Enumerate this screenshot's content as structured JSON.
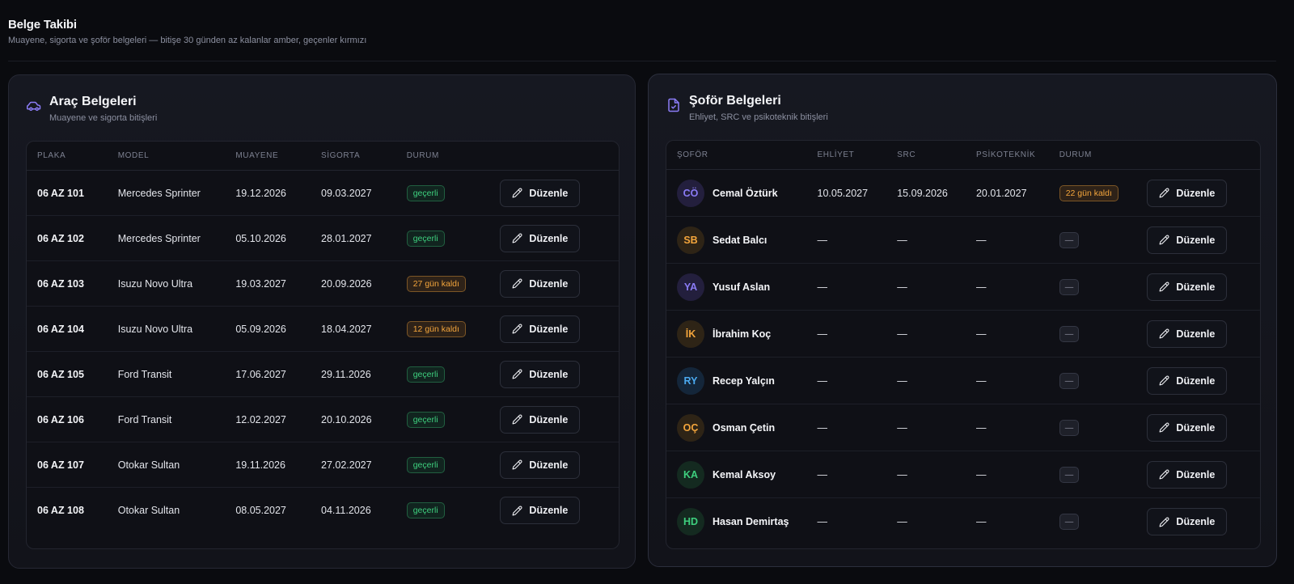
{
  "page": {
    "title": "Belge Takibi",
    "subtitle": "Muayene, sigorta ve şoför belgeleri — bitişe 30 günden az kalanlar amber, geçenler kırmızı"
  },
  "vehicle_panel": {
    "icon": "car-icon",
    "title": "Araç Belgeleri",
    "subtitle": "Muayene ve sigorta bitişleri",
    "columns": [
      "PLAKA",
      "MODEL",
      "MUAYENE",
      "SİGORTA",
      "DURUM",
      ""
    ],
    "rows": [
      {
        "plate": "06 AZ 101",
        "model": "Mercedes Sprinter",
        "inspection": "19.12.2026",
        "insurance": "09.03.2027",
        "status": "geçerli",
        "status_type": "ok",
        "action": "Düzenle"
      },
      {
        "plate": "06 AZ 102",
        "model": "Mercedes Sprinter",
        "inspection": "05.10.2026",
        "insurance": "28.01.2027",
        "status": "geçerli",
        "status_type": "ok",
        "action": "Düzenle"
      },
      {
        "plate": "06 AZ 103",
        "model": "Isuzu Novo Ultra",
        "inspection": "19.03.2027",
        "insurance": "20.09.2026",
        "status": "27 gün kaldı",
        "status_type": "warn",
        "action": "Düzenle"
      },
      {
        "plate": "06 AZ 104",
        "model": "Isuzu Novo Ultra",
        "inspection": "05.09.2026",
        "insurance": "18.04.2027",
        "status": "12 gün kaldı",
        "status_type": "warn",
        "action": "Düzenle"
      },
      {
        "plate": "06 AZ 105",
        "model": "Ford Transit",
        "inspection": "17.06.2027",
        "insurance": "29.11.2026",
        "status": "geçerli",
        "status_type": "ok",
        "action": "Düzenle"
      },
      {
        "plate": "06 AZ 106",
        "model": "Ford Transit",
        "inspection": "12.02.2027",
        "insurance": "20.10.2026",
        "status": "geçerli",
        "status_type": "ok",
        "action": "Düzenle"
      },
      {
        "plate": "06 AZ 107",
        "model": "Otokar Sultan",
        "inspection": "19.11.2026",
        "insurance": "27.02.2027",
        "status": "geçerli",
        "status_type": "ok",
        "action": "Düzenle"
      },
      {
        "plate": "06 AZ 108",
        "model": "Otokar Sultan",
        "inspection": "08.05.2027",
        "insurance": "04.11.2026",
        "status": "geçerli",
        "status_type": "ok",
        "action": "Düzenle"
      }
    ]
  },
  "driver_panel": {
    "icon": "document-check-icon",
    "title": "Şoför Belgeleri",
    "subtitle": "Ehliyet, SRC ve psikoteknik bitişleri",
    "columns": [
      "ŞOFÖR",
      "EHLİYET",
      "SRC",
      "PSİKOTEKNİK",
      "DURUM",
      ""
    ],
    "rows": [
      {
        "initials": "CÖ",
        "name": "Cemal Öztürk",
        "license": "10.05.2027",
        "src": "15.09.2026",
        "psycho": "20.01.2027",
        "status": "22 gün kaldı",
        "status_type": "warn",
        "avatar_fg": "#8b7cf6",
        "avatar_bg": "#231f3d",
        "action": "Düzenle"
      },
      {
        "initials": "SB",
        "name": "Sedat Balcı",
        "license": "—",
        "src": "—",
        "psycho": "—",
        "status": "—",
        "status_type": "none",
        "avatar_fg": "#f3a53c",
        "avatar_bg": "#2e2416",
        "action": "Düzenle"
      },
      {
        "initials": "YA",
        "name": "Yusuf Aslan",
        "license": "—",
        "src": "—",
        "psycho": "—",
        "status": "—",
        "status_type": "none",
        "avatar_fg": "#8b7cf6",
        "avatar_bg": "#231f3d",
        "action": "Düzenle"
      },
      {
        "initials": "İK",
        "name": "İbrahim Koç",
        "license": "—",
        "src": "—",
        "psycho": "—",
        "status": "—",
        "status_type": "none",
        "avatar_fg": "#f3a53c",
        "avatar_bg": "#2e2416",
        "action": "Düzenle"
      },
      {
        "initials": "RY",
        "name": "Recep Yalçın",
        "license": "—",
        "src": "—",
        "psycho": "—",
        "status": "—",
        "status_type": "none",
        "avatar_fg": "#4ba9ef",
        "avatar_bg": "#14263a",
        "action": "Düzenle"
      },
      {
        "initials": "OÇ",
        "name": "Osman Çetin",
        "license": "—",
        "src": "—",
        "psycho": "—",
        "status": "—",
        "status_type": "none",
        "avatar_fg": "#f3a53c",
        "avatar_bg": "#2e2416",
        "action": "Düzenle"
      },
      {
        "initials": "KA",
        "name": "Kemal Aksoy",
        "license": "—",
        "src": "—",
        "psycho": "—",
        "status": "—",
        "status_type": "none",
        "avatar_fg": "#3ecf7e",
        "avatar_bg": "#142a20",
        "action": "Düzenle"
      },
      {
        "initials": "HD",
        "name": "Hasan Demirtaş",
        "license": "—",
        "src": "—",
        "psycho": "—",
        "status": "—",
        "status_type": "none",
        "avatar_fg": "#3ecf7e",
        "avatar_bg": "#142a20",
        "action": "Düzenle"
      }
    ]
  },
  "colors": {
    "accent": "#8b7cf6",
    "ok": "#3ecf7e",
    "warn": "#f3a53c"
  }
}
